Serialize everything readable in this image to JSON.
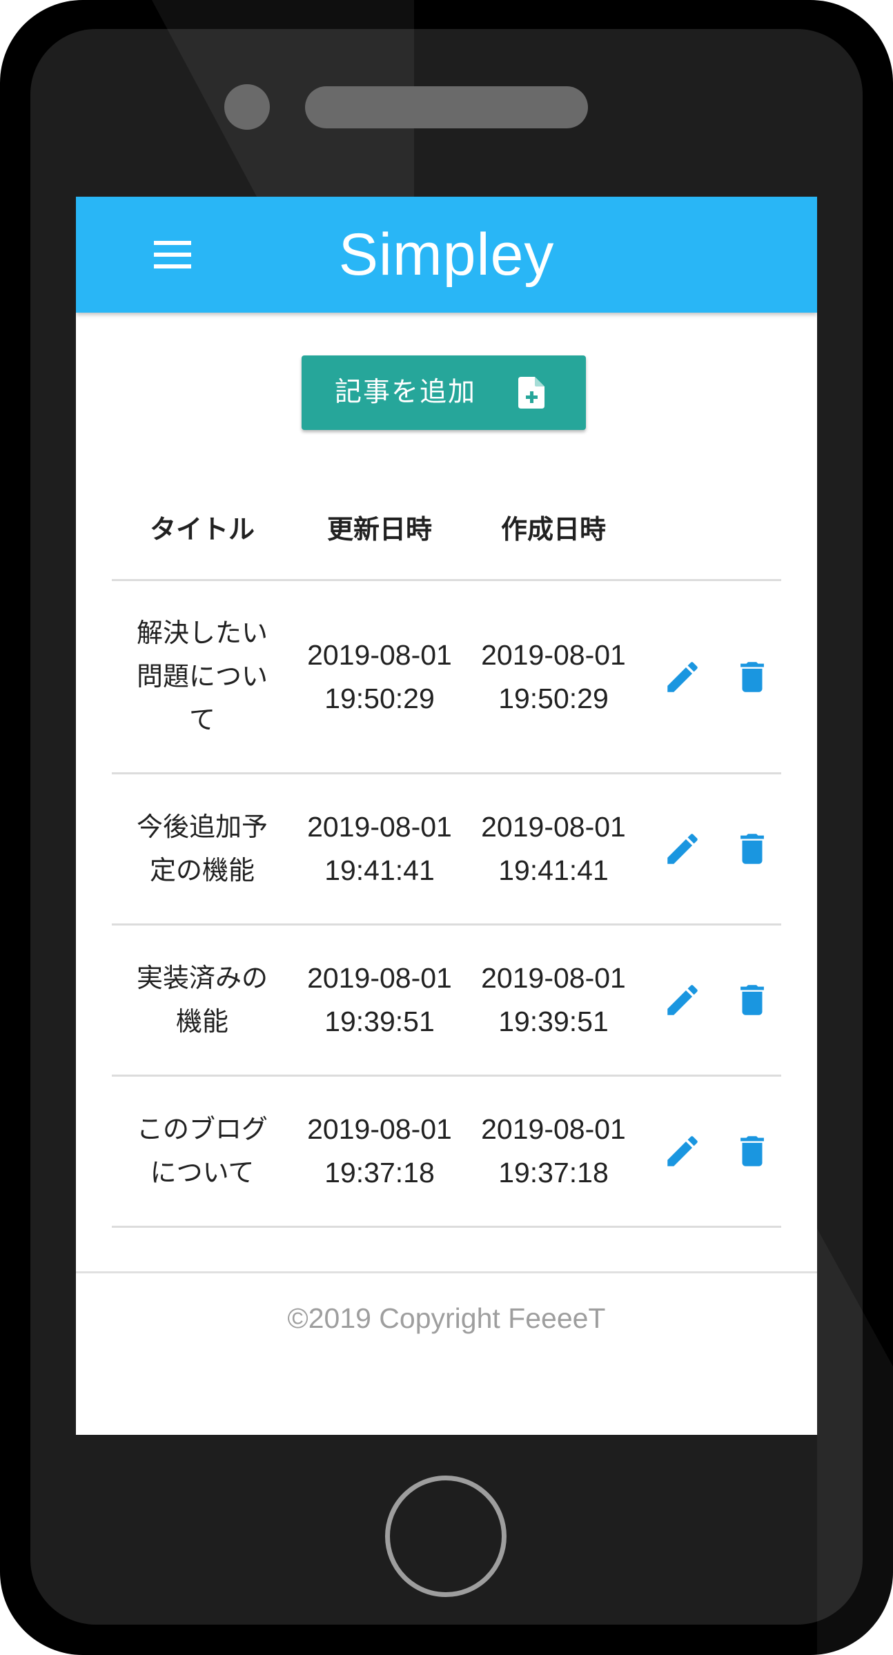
{
  "app": {
    "title": "Simpley",
    "menu_icon": "hamburger-menu-icon"
  },
  "actions": {
    "add_article_label": "記事を追加",
    "add_article_icon": "file-plus-icon"
  },
  "table": {
    "columns": [
      "タイトル",
      "更新日時",
      "作成日時"
    ],
    "rows": [
      {
        "title": "解決したい問題について",
        "updated_date": "2019-08-01",
        "updated_time": "19:50:29",
        "created_date": "2019-08-01",
        "created_time": "19:50:29"
      },
      {
        "title": "今後追加予定の機能",
        "updated_date": "2019-08-01",
        "updated_time": "19:41:41",
        "created_date": "2019-08-01",
        "created_time": "19:41:41"
      },
      {
        "title": "実装済みの機能",
        "updated_date": "2019-08-01",
        "updated_time": "19:39:51",
        "created_date": "2019-08-01",
        "created_time": "19:39:51"
      },
      {
        "title": "このブログについて",
        "updated_date": "2019-08-01",
        "updated_time": "19:37:18",
        "created_date": "2019-08-01",
        "created_time": "19:37:18"
      }
    ],
    "row_icons": {
      "edit": "pencil-icon",
      "delete": "trash-icon"
    }
  },
  "footer": {
    "copyright": "©2019 Copyright FeeeeT"
  },
  "colors": {
    "app_bar": "#29b6f6",
    "add_button": "#26a69a",
    "action_icon": "#1a96e0",
    "footer_text": "#9e9e9e"
  }
}
